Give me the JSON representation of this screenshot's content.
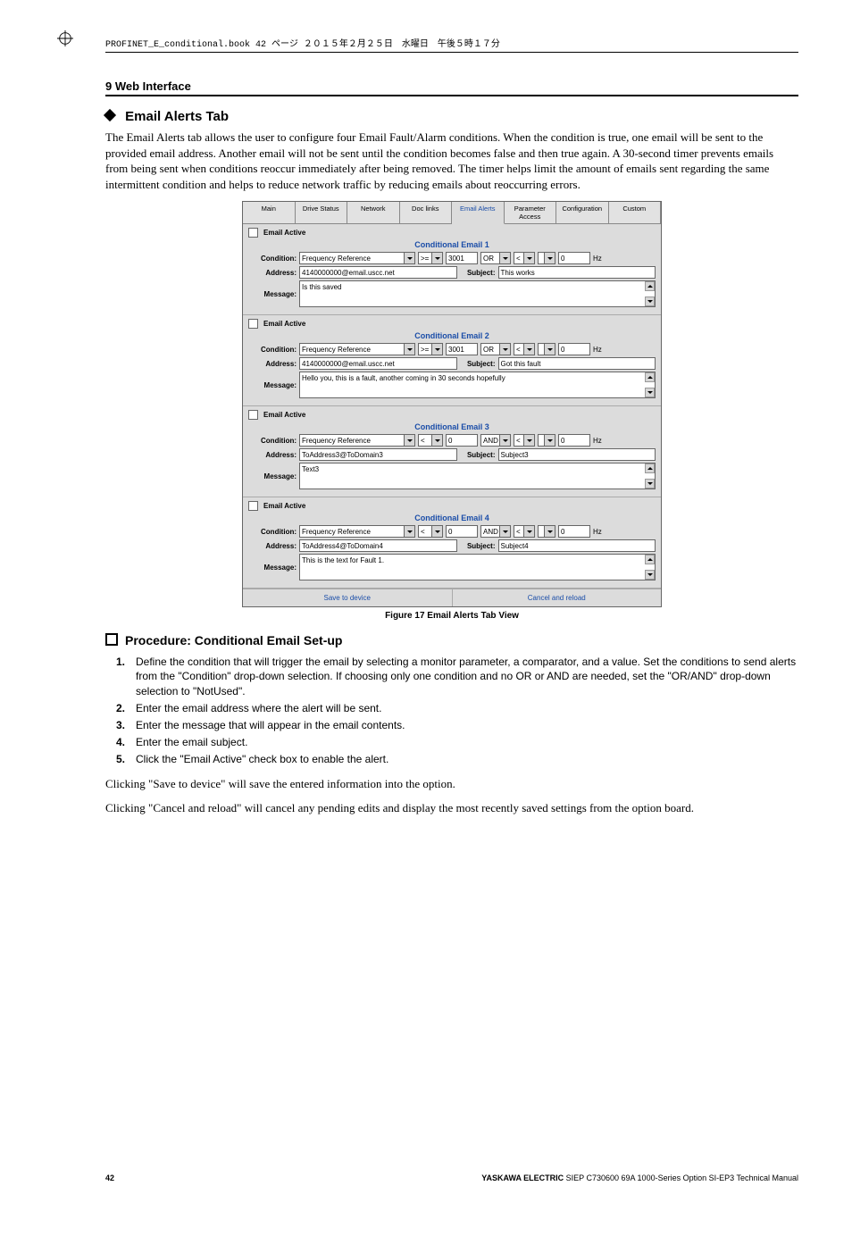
{
  "header_path": "PROFINET_E_conditional.book  42 ページ   ２０１５年２月２５日　水曜日　午後５時１７分",
  "section_top": "9  Web Interface",
  "section_title": "Email Alerts Tab",
  "intro_para": "The Email Alerts tab allows the user to configure four Email Fault/Alarm conditions. When the condition is true, one email will be sent to the provided email address. Another email will not be sent until the condition becomes false and then true again. A 30-second timer prevents emails from being sent when conditions reoccur immediately after being removed. The timer helps limit the amount of emails sent regarding the same intermittent condition and helps to reduce network traffic by reducing emails about reoccurring errors.",
  "figure_caption": "Figure 17  Email Alerts Tab View",
  "procedure_heading": "Procedure: Conditional Email Set-up",
  "steps": {
    "1": "Define the condition that will trigger the email by selecting a monitor parameter, a comparator, and a value. Set the conditions to send alerts from the \"Condition\" drop-down selection. If choosing only one condition and no OR or AND are needed, set the \"OR/AND\" drop-down selection to \"NotUsed\".",
    "2": "Enter the email address where the alert will be sent.",
    "3": "Enter the message that will appear in the email contents.",
    "4": "Enter the email subject.",
    "5": "Click the \"Email Active\" check box to enable the alert."
  },
  "para_save": "Clicking \"Save to device\" will save the entered information into the option.",
  "para_cancel": "Clicking \"Cancel and reload\" will cancel any pending edits and display the most recently saved settings from the option board.",
  "footer": {
    "page": "42",
    "company": "YASKAWA ELECTRIC",
    "doc": " SIEP C730600 69A 1000-Series Option SI-EP3 Technical Manual"
  },
  "ui": {
    "tabs": [
      "Main",
      "Drive Status",
      "Network",
      "Doc links",
      "Email Alerts",
      "Parameter Access",
      "Configuration",
      "Custom"
    ],
    "active_tab": "Email Alerts",
    "labels": {
      "email_active": "Email Active",
      "condition": "Condition:",
      "address": "Address:",
      "message": "Message:",
      "subject": "Subject:"
    },
    "unit": "Hz",
    "buttons": {
      "save": "Save to device",
      "cancel": "Cancel and reload"
    },
    "emails": [
      {
        "title": "Conditional Email 1",
        "param": "Frequency Reference",
        "cmp": ">=",
        "val": "3001",
        "logic": "OR",
        "cmp2": "<",
        "val2": "0",
        "address": "4140000000@email.uscc.net",
        "subject": "This works",
        "message": "Is this saved"
      },
      {
        "title": "Conditional Email 2",
        "param": "Frequency Reference",
        "cmp": ">=",
        "val": "3001",
        "logic": "OR",
        "cmp2": "<",
        "val2": "0",
        "address": "4140000000@email.uscc.net",
        "subject": "Got this fault",
        "message": "Hello you, this is a fault, another coming in 30 seconds hopefully"
      },
      {
        "title": "Conditional Email 3",
        "param": "Frequency Reference",
        "cmp": "<",
        "val": "0",
        "logic": "AND",
        "cmp2": "<",
        "val2": "0",
        "address": "ToAddress3@ToDomain3",
        "subject": "Subject3",
        "message": "Text3"
      },
      {
        "title": "Conditional Email 4",
        "param": "Frequency Reference",
        "cmp": "<",
        "val": "0",
        "logic": "AND",
        "cmp2": "<",
        "val2": "0",
        "address": "ToAddress4@ToDomain4",
        "subject": "Subject4",
        "message": "This is the text for Fault 1."
      }
    ]
  }
}
